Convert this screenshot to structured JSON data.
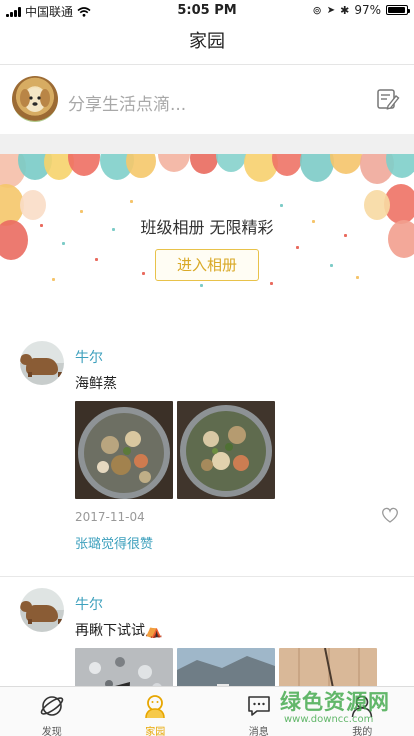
{
  "status_bar": {
    "carrier": "中国联通",
    "time": "5:05 PM",
    "battery": "97%",
    "battery_level": 0.97
  },
  "nav": {
    "title": "家园"
  },
  "share": {
    "placeholder": "分享生活点滴..."
  },
  "album_banner": {
    "title": "班级相册 无限精彩",
    "button_label": "进入相册"
  },
  "posts": [
    {
      "name": "牛尔",
      "text": "海鲜蒸",
      "date": "2017-11-04",
      "like_text": "张璐觉得很赞"
    },
    {
      "name": "牛尔",
      "text": "再瞅下试试⛺"
    }
  ],
  "watermark": {
    "text": "绿色资源网",
    "url": "www.downcc.com"
  },
  "tab_bar": {
    "tabs": [
      {
        "label": "发现",
        "icon": "planet-icon"
      },
      {
        "label": "家园",
        "icon": "home-icon",
        "active": true
      },
      {
        "label": "消息",
        "icon": "message-icon"
      },
      {
        "label": "我的",
        "icon": "profile-icon"
      }
    ]
  },
  "colors": {
    "accent": "#e7a600",
    "link_blue": "#3da0bd",
    "gap_gray": "#f0f0f0"
  }
}
